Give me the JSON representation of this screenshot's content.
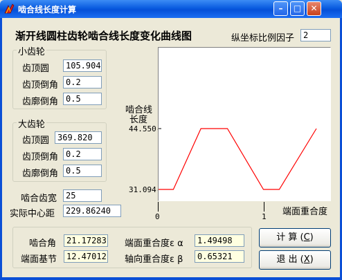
{
  "window": {
    "title": "啮合线长度计算"
  },
  "header": {
    "title": "渐开线圆柱齿轮啮合线长度变化曲线图",
    "scale_label": "纵坐标比例因子",
    "scale_value": "2"
  },
  "small_gear": {
    "title": "小齿轮",
    "tip_label": "齿顶圆",
    "tip_value": "105.904",
    "tip_chamfer_label": "齿顶倒角",
    "tip_chamfer_value": "0.2",
    "profile_chamfer_label": "齿廓倒角",
    "profile_chamfer_value": "0.5"
  },
  "large_gear": {
    "title": "大齿轮",
    "tip_label": "齿顶圆",
    "tip_value": "369.820",
    "tip_chamfer_label": "齿顶倒角",
    "tip_chamfer_value": "0.2",
    "profile_chamfer_label": "齿廓倒角",
    "profile_chamfer_value": "0.5"
  },
  "mesh": {
    "face_width_label": "啮合齿宽",
    "face_width_value": "25",
    "center_distance_label": "实际中心距",
    "center_distance_value": "229.86240"
  },
  "results": {
    "pressure_angle_label": "啮合角",
    "pressure_angle_value": "21.17283",
    "base_pitch_label": "端面基节",
    "base_pitch_value": "12.47012",
    "transverse_ratio_label": "端面重合度ε α",
    "transverse_ratio_value": "1.49498",
    "axial_ratio_label": "轴向重合度ε β",
    "axial_ratio_value": "0.65321"
  },
  "buttons": {
    "calculate": "计 算",
    "calculate_key": "C",
    "exit": "退 出",
    "exit_key": "X"
  },
  "chart_data": {
    "type": "line",
    "ylabel_line1": "啮合线",
    "ylabel_line2": "长度",
    "xlabel": "端面重合度",
    "y_ticks": [
      "44.550-",
      "31.094-"
    ],
    "x_ticks": [
      "0",
      "1"
    ],
    "y_values_ref": [
      31.094,
      44.55
    ],
    "series": [
      {
        "color": "#ff0000",
        "x": [
          0,
          0.14,
          0.4,
          0.65,
          0.99,
          1.14,
          1.49
        ],
        "y": [
          31.094,
          31.094,
          44.55,
          44.55,
          31.094,
          31.094,
          44.55
        ]
      }
    ],
    "xlim": [
      0,
      1.5
    ]
  }
}
